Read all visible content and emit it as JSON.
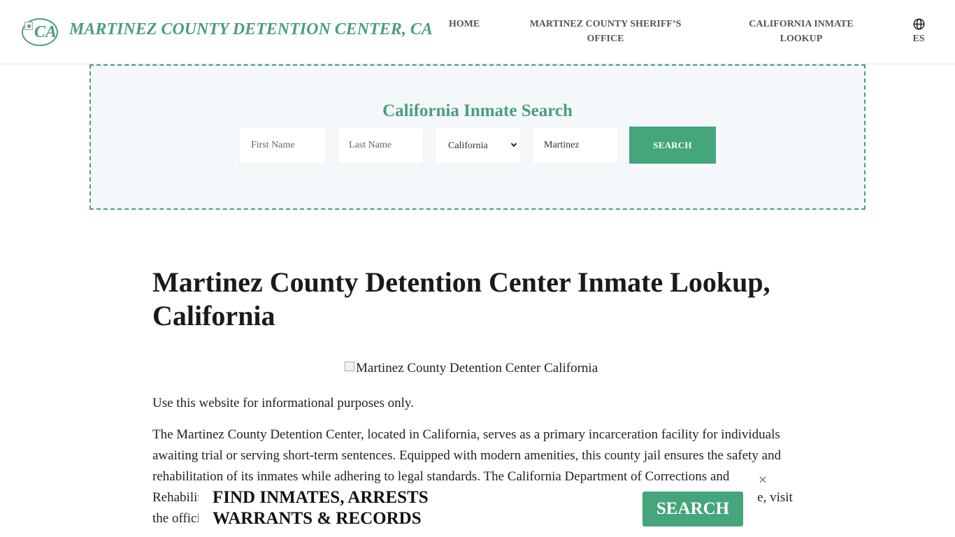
{
  "header": {
    "logo_text": "CA",
    "site_title": "MARTINEZ COUNTY DETENTION CENTER, CA",
    "nav": {
      "home": "HOME",
      "sheriff": "MARTINEZ COUNTY SHERIFF’S OFFICE",
      "lookup": "CALIFORNIA INMATE LOOKUP",
      "lang": "ES"
    }
  },
  "search": {
    "title": "California Inmate Search",
    "first_name_placeholder": "First Name",
    "last_name_placeholder": "Last Name",
    "state_selected": "California",
    "city_value": "Martinez",
    "button_label": "SEARCH"
  },
  "content": {
    "title": "Martinez County Detention Center Inmate Lookup, California",
    "image_alt": "Martinez County Detention Center California",
    "para1": "Use this website for informational purposes only.",
    "para2": "The Martinez County Detention Center, located in California, serves as a primary incarceration facility for individuals awaiting trial or serving short-term sentences. Equipped with modern amenities, this county jail ensures the safety and rehabilitation of its inmates while adhering to legal standards. The California Department of Corrections and Rehabilitation oversees the operations of this facility. For more information about correctional facilities in the state, visit the official website."
  },
  "banner": {
    "line1": "FIND INMATES, ARRESTS",
    "line2": "WARRANTS & RECORDS",
    "button_label": "SEARCH",
    "close_label": "×"
  },
  "colors": {
    "brand_green": "#4a9e7c",
    "button_green": "#45a57b",
    "panel_bg": "#f4f8fa"
  },
  "icons": {
    "language": "globe-icon",
    "close": "close-icon",
    "select": "chevron-down-icon"
  }
}
